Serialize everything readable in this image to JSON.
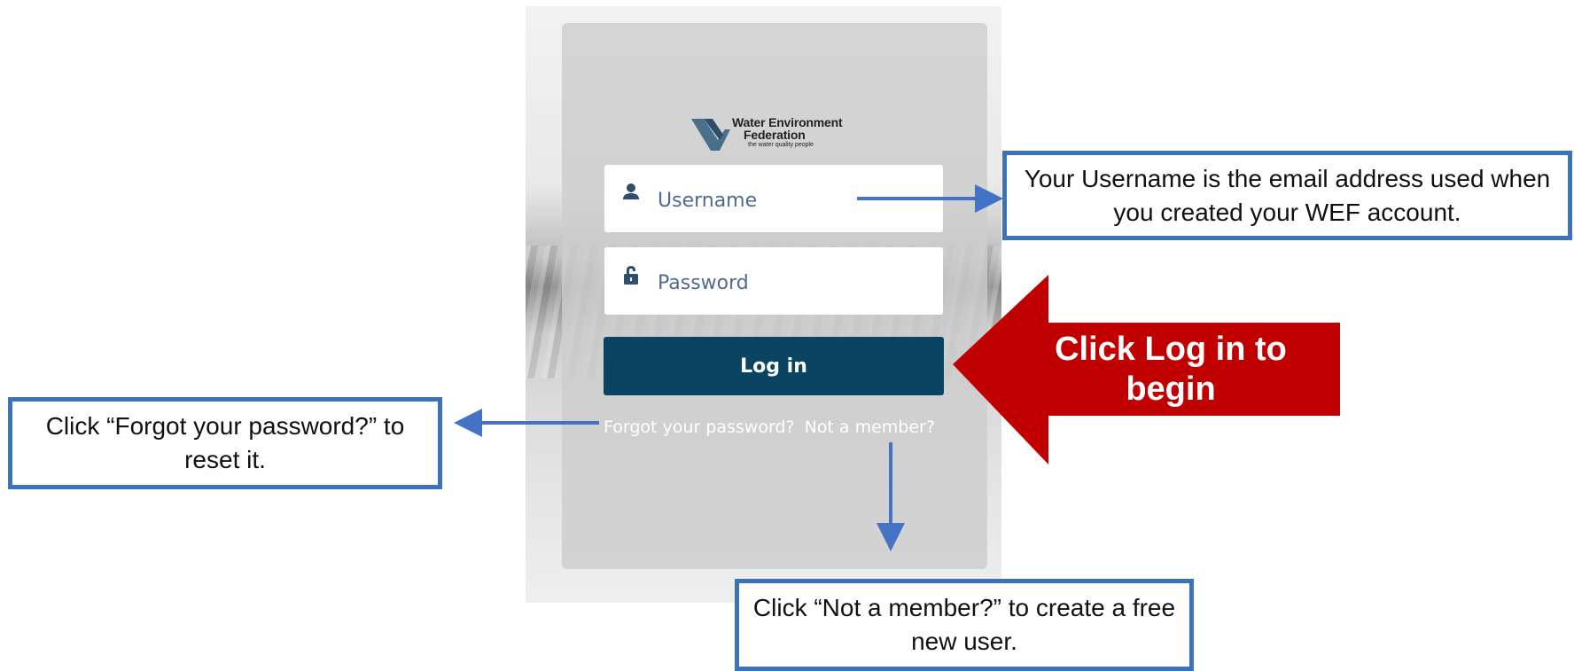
{
  "login_form": {
    "logo": {
      "line1": "Water Environment",
      "line2": "Federation",
      "tagline": "the water quality people"
    },
    "username": {
      "placeholder": "Username",
      "icon": "user-icon"
    },
    "password": {
      "placeholder": "Password",
      "icon": "lock-icon"
    },
    "login_button_label": "Log in",
    "forgot_link": "Forgot your password?",
    "member_link": "Not a member?"
  },
  "annotations": {
    "username_note": "Your Username is the email address used when you created your WEF account.",
    "forgot_note": "Click “Forgot your password?” to reset it.",
    "member_note": "Click “Not a member?” to create a free new user.",
    "login_note": "Click Log in to begin"
  },
  "colors": {
    "button_bg": "#0b4363",
    "callout_border": "#3b72ba",
    "arrow_red": "#c00000",
    "pointer_blue": "#4472c4"
  }
}
